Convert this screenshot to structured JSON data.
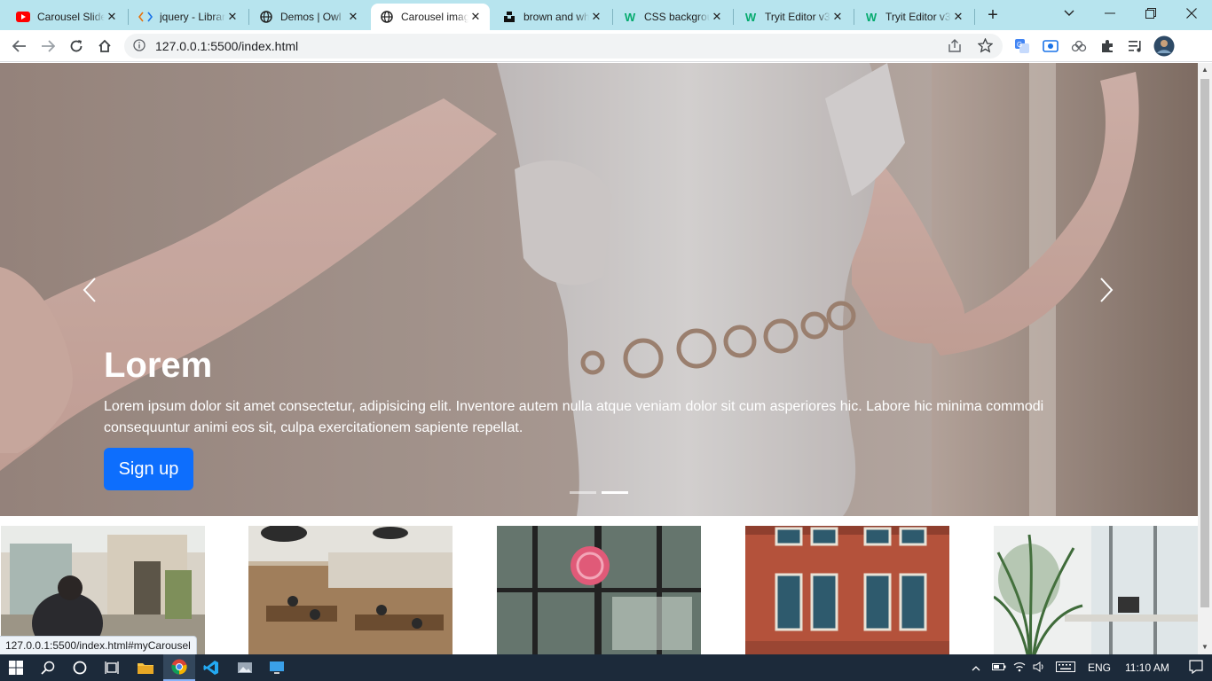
{
  "browser": {
    "tabs": [
      {
        "title": "Carousel Slider",
        "favicon": "youtube-icon"
      },
      {
        "title": "jquery - Library",
        "favicon": "code-icon"
      },
      {
        "title": "Demos | Owl",
        "favicon": "globe-icon"
      },
      {
        "title": "Carousel image",
        "favicon": "globe-icon",
        "active": true
      },
      {
        "title": "brown and white",
        "favicon": "unsplash-icon"
      },
      {
        "title": "CSS background",
        "favicon": "w3schools-icon"
      },
      {
        "title": "Tryit Editor v3",
        "favicon": "w3schools-icon"
      },
      {
        "title": "Tryit Editor v3",
        "favicon": "w3schools-icon"
      }
    ],
    "url": "127.0.0.1:5500/index.html",
    "status_url": "127.0.0.1:5500/index.html#myCarousel"
  },
  "carousel": {
    "heading": "Lorem",
    "text": "Lorem ipsum dolor sit amet consectetur, adipisicing elit. Inventore autem nulla atque veniam dolor sit cum asperiores hic. Labore hic minima commodi consequuntur animi eos sit, culpa exercitationem sapiente repellat.",
    "button_label": "Sign up",
    "slide_count": 2,
    "active_slide": 2
  },
  "thumbnails": [
    "street-photo",
    "coworking-space-photo",
    "window-sign-photo",
    "brick-building-photo",
    "office-plants-photo"
  ],
  "taskbar": {
    "language": "ENG",
    "time": "11:10 AM"
  },
  "colors": {
    "tabstrip": "#b7e4ee",
    "button": "#0d6efd",
    "taskbar": "#1c2a3a"
  }
}
